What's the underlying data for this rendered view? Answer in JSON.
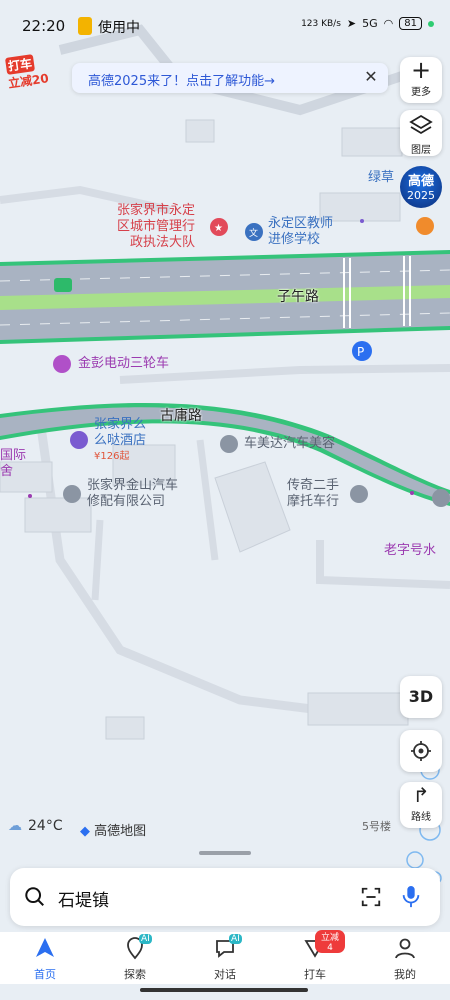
{
  "status_bar": {
    "time": "22:20",
    "app_in_use": "使用中",
    "network_speed": "123 KB/s",
    "signal": "5G",
    "battery": "81"
  },
  "promo": {
    "line1": "打车",
    "line2": "立减20"
  },
  "banner": {
    "text": "高德2025来了！点击了解功能→"
  },
  "side_buttons": {
    "more_label": "更多",
    "layers_label": "图层",
    "gd2025_a": "高德",
    "gd2025_b": "2025"
  },
  "map": {
    "roads": [
      {
        "name": "子午路"
      },
      {
        "name": "古庸路"
      }
    ],
    "pois": [
      {
        "name": "张家界市永定区城市管理行政执法大队",
        "lines": [
          "张家界市永定",
          "区城市管理行",
          "政执法大队"
        ]
      },
      {
        "name": "永定区教师进修学校",
        "lines": [
          "永定区教师",
          "进修学校"
        ]
      },
      {
        "name": "绿草",
        "lines": [
          "绿草"
        ]
      },
      {
        "name": "金彭电动三轮车",
        "lines": [
          "金彭电动三轮车"
        ]
      },
      {
        "name": "张家界么么哒酒店",
        "lines": [
          "张家界么",
          "么哒酒店"
        ],
        "price": "¥126起"
      },
      {
        "name": "车美达汽车美容",
        "lines": [
          "车美达汽车美容"
        ]
      },
      {
        "name": "国际舍",
        "lines": [
          "国际",
          "舍"
        ]
      },
      {
        "name": "张家界金山汽车修配有限公司",
        "lines": [
          "张家界金山汽车",
          "修配有限公司"
        ]
      },
      {
        "name": "传奇二手摩托车行",
        "lines": [
          "传奇二手",
          "摩托车行"
        ]
      },
      {
        "name": "老字号水",
        "lines": [
          "老字号水"
        ]
      }
    ]
  },
  "controls": {
    "btn_3d": "3D",
    "nav_label": "路线"
  },
  "footer_info": {
    "temperature": "24°C",
    "map_brand": "高德地图",
    "building": "5号楼"
  },
  "search": {
    "value": "石堤镇"
  },
  "tabs": [
    {
      "label": "首页",
      "active": true
    },
    {
      "label": "探索",
      "badge": "AI"
    },
    {
      "label": "对话",
      "badge": "AI"
    },
    {
      "label": "打车",
      "badge": "立减4"
    },
    {
      "label": "我的"
    }
  ],
  "colors": {
    "accent": "#2b6ff0",
    "road": "#a9b3c2",
    "road_edge": "#35c37a",
    "median": "#a8e08a"
  }
}
